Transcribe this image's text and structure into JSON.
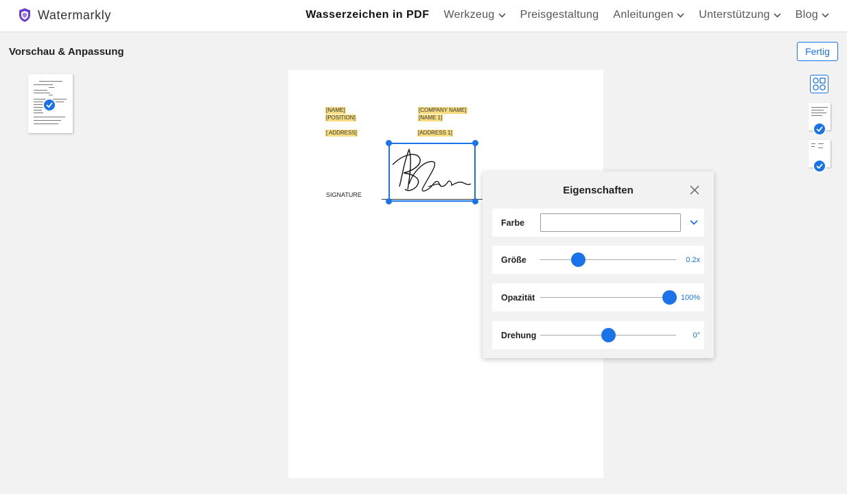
{
  "brand": {
    "name": "Watermarkly"
  },
  "nav": {
    "items": [
      {
        "label": "Wasserzeichen in PDF",
        "active": true,
        "dropdown": false
      },
      {
        "label": "Werkzeug",
        "active": false,
        "dropdown": true
      },
      {
        "label": "Preisgestaltung",
        "active": false,
        "dropdown": false
      },
      {
        "label": "Anleitungen",
        "active": false,
        "dropdown": true
      },
      {
        "label": "Unterstützung",
        "active": false,
        "dropdown": true
      },
      {
        "label": "Blog",
        "active": false,
        "dropdown": true
      }
    ]
  },
  "toolbar": {
    "title": "Vorschau & Anpassung",
    "done_label": "Fertig"
  },
  "document": {
    "fields": {
      "name": "[NAME]",
      "position": "[POSITION]",
      "address": "[ ADDRESS]",
      "company_name": "[COMPANY NAME]",
      "name1": "[NAME 1]",
      "address1": "[ADDRESS 1]"
    },
    "signature_label": "SIGNATURE"
  },
  "properties": {
    "title": "Eigenschaften",
    "color": {
      "label": "Farbe",
      "value": ""
    },
    "size": {
      "label": "Größe",
      "value": "0.2x",
      "fraction": 0.28
    },
    "opacity": {
      "label": "Opazität",
      "value": "100%",
      "fraction": 0.95
    },
    "rotation": {
      "label": "Drehung",
      "value": "0°",
      "fraction": 0.5
    }
  },
  "colors": {
    "accent": "#1a73e8",
    "highlight": "#f7dd80",
    "logo": "#6a3fd6"
  },
  "icons": [
    "shield-logo-icon",
    "chevron-down-icon",
    "check-icon",
    "close-icon",
    "layout-grid-icon"
  ]
}
